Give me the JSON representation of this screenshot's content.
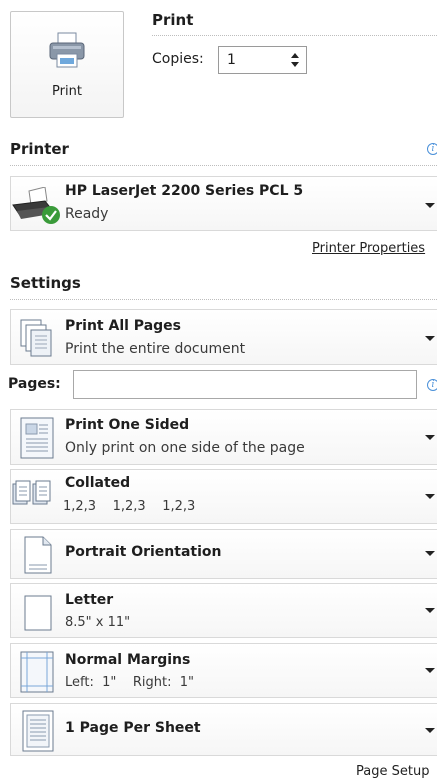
{
  "print": {
    "button_label": "Print",
    "section_title": "Print",
    "copies_label": "Copies:",
    "copies_value": "1"
  },
  "printer": {
    "section_title": "Printer",
    "name": "HP LaserJet 2200 Series PCL 5",
    "status": "Ready",
    "properties_link": "Printer Properties"
  },
  "settings": {
    "section_title": "Settings",
    "pages_label": "Pages:",
    "pages_value": "",
    "items": [
      {
        "title": "Print All Pages",
        "subtitle": "Print the entire document",
        "icon": "pages-stack-icon"
      },
      {
        "title": "Print One Sided",
        "subtitle": "Only print on one side of the page",
        "icon": "one-sided-icon"
      },
      {
        "title": "Collated",
        "subtitle": "1,2,3    1,2,3    1,2,3",
        "icon": "collated-icon"
      },
      {
        "title": "Portrait Orientation",
        "subtitle": "",
        "icon": "portrait-icon"
      },
      {
        "title": "Letter",
        "subtitle": "8.5\" x 11\"",
        "icon": "letter-paper-icon"
      },
      {
        "title": "Normal Margins",
        "subtitle": "Left:  1\"    Right:  1\"",
        "icon": "margins-icon"
      },
      {
        "title": "1 Page Per Sheet",
        "subtitle": "",
        "icon": "page-per-sheet-icon"
      }
    ],
    "page_setup_link": "Page Setup"
  },
  "colors": {
    "info_blue": "#4a90d9",
    "ready_green": "#3a9b3a"
  }
}
